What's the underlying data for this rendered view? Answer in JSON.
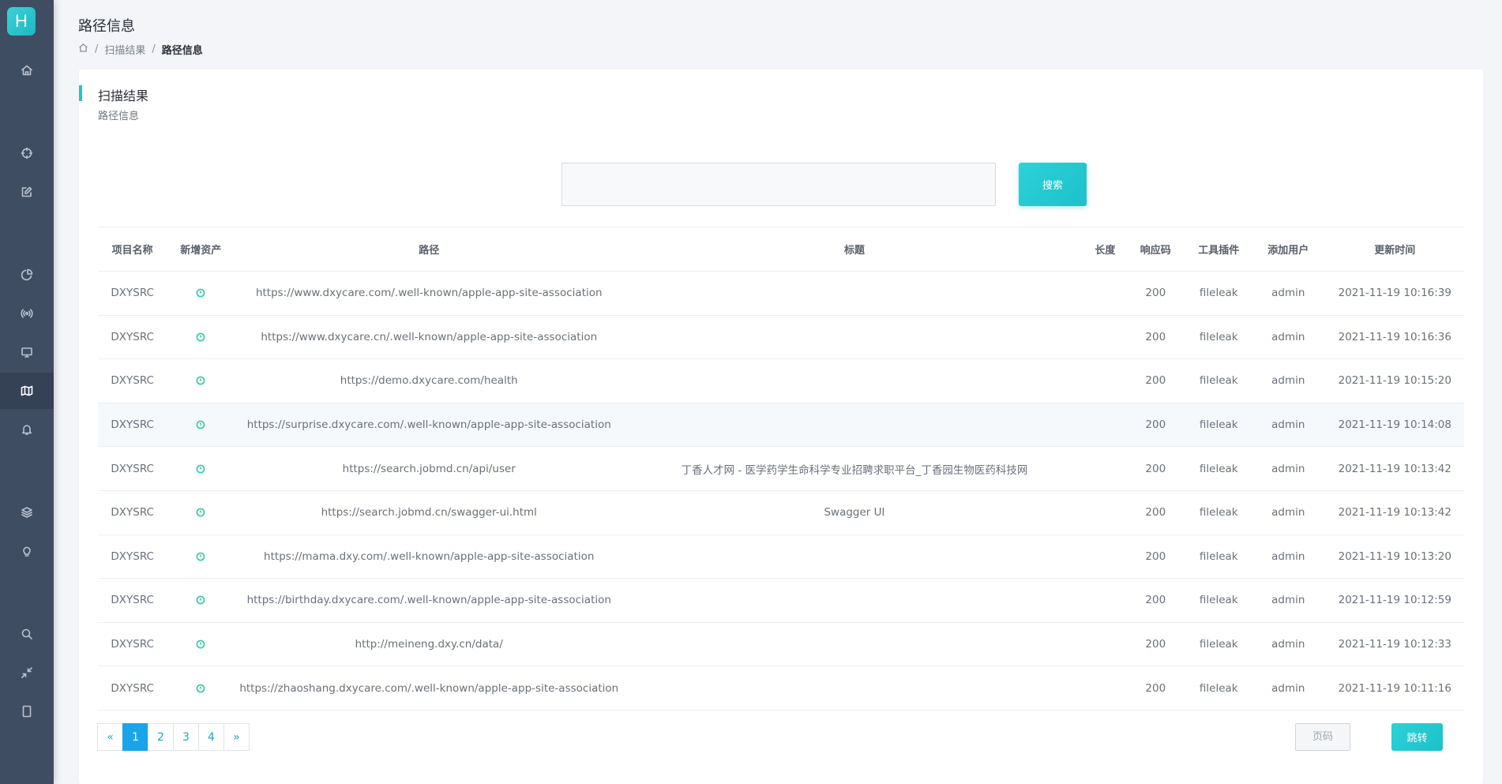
{
  "app": {
    "logo_letter": "H"
  },
  "header": {
    "title": "路径信息",
    "breadcrumb": [
      "扫描结果",
      "路径信息"
    ]
  },
  "card": {
    "title": "扫描结果",
    "subtitle": "路径信息"
  },
  "search": {
    "placeholder": "",
    "value": "",
    "button_label": "搜索"
  },
  "sidebar": {
    "items": [
      {
        "icon": "home-icon",
        "active": false
      },
      {
        "icon": "crosshair-icon",
        "active": false
      },
      {
        "icon": "edit-icon",
        "active": false
      },
      {
        "icon": "pie-chart-icon",
        "active": false
      },
      {
        "icon": "radio-signal-icon",
        "active": false
      },
      {
        "icon": "monitor-icon",
        "active": false
      },
      {
        "icon": "map-icon",
        "active": true
      },
      {
        "icon": "bell-icon",
        "active": false
      },
      {
        "icon": "layers-icon",
        "active": false
      },
      {
        "icon": "bulb-icon",
        "active": false
      },
      {
        "icon": "search-icon",
        "active": false
      },
      {
        "icon": "minimize-icon",
        "active": false
      },
      {
        "icon": "tablet-icon",
        "active": false
      }
    ]
  },
  "table": {
    "columns": [
      "项目名称",
      "新增资产",
      "路径",
      "标题",
      "长度",
      "响应码",
      "工具插件",
      "添加用户",
      "更新时间"
    ],
    "rows": [
      {
        "project": "DXYSRC",
        "path": "https://www.dxycare.com/.well-known/apple-app-site-association",
        "title": "",
        "length": "",
        "code": "200",
        "plugin": "fileleak",
        "user": "admin",
        "time": "2021-11-19 10:16:39"
      },
      {
        "project": "DXYSRC",
        "path": "https://www.dxycare.cn/.well-known/apple-app-site-association",
        "title": "",
        "length": "",
        "code": "200",
        "plugin": "fileleak",
        "user": "admin",
        "time": "2021-11-19 10:16:36"
      },
      {
        "project": "DXYSRC",
        "path": "https://demo.dxycare.com/health",
        "title": "",
        "length": "",
        "code": "200",
        "plugin": "fileleak",
        "user": "admin",
        "time": "2021-11-19 10:15:20"
      },
      {
        "project": "DXYSRC",
        "path": "https://surprise.dxycare.com/.well-known/apple-app-site-association",
        "title": "",
        "length": "",
        "code": "200",
        "plugin": "fileleak",
        "user": "admin",
        "time": "2021-11-19 10:14:08"
      },
      {
        "project": "DXYSRC",
        "path": "https://search.jobmd.cn/api/user",
        "title": "丁香人才网 - 医学药学生命科学专业招聘求职平台_丁香园生物医药科技网",
        "length": "",
        "code": "200",
        "plugin": "fileleak",
        "user": "admin",
        "time": "2021-11-19 10:13:42"
      },
      {
        "project": "DXYSRC",
        "path": "https://search.jobmd.cn/swagger-ui.html",
        "title": "Swagger UI",
        "length": "",
        "code": "200",
        "plugin": "fileleak",
        "user": "admin",
        "time": "2021-11-19 10:13:42"
      },
      {
        "project": "DXYSRC",
        "path": "https://mama.dxy.com/.well-known/apple-app-site-association",
        "title": "",
        "length": "",
        "code": "200",
        "plugin": "fileleak",
        "user": "admin",
        "time": "2021-11-19 10:13:20"
      },
      {
        "project": "DXYSRC",
        "path": "https://birthday.dxycare.com/.well-known/apple-app-site-association",
        "title": "",
        "length": "",
        "code": "200",
        "plugin": "fileleak",
        "user": "admin",
        "time": "2021-11-19 10:12:59"
      },
      {
        "project": "DXYSRC",
        "path": "http://meineng.dxy.cn/data/",
        "title": "",
        "length": "",
        "code": "200",
        "plugin": "fileleak",
        "user": "admin",
        "time": "2021-11-19 10:12:33"
      },
      {
        "project": "DXYSRC",
        "path": "https://zhaoshang.dxycare.com/.well-known/apple-app-site-association",
        "title": "",
        "length": "",
        "code": "200",
        "plugin": "fileleak",
        "user": "admin",
        "time": "2021-11-19 10:11:16"
      }
    ]
  },
  "pagination": {
    "prev": "«",
    "pages": [
      "1",
      "2",
      "3",
      "4"
    ],
    "current": "1",
    "next": "»",
    "page_input_placeholder": "页码",
    "jump_label": "跳转"
  },
  "colors": {
    "accent": "#1ec0c9",
    "sidebar": "#3f4d63",
    "page_active": "#19a5e9"
  }
}
